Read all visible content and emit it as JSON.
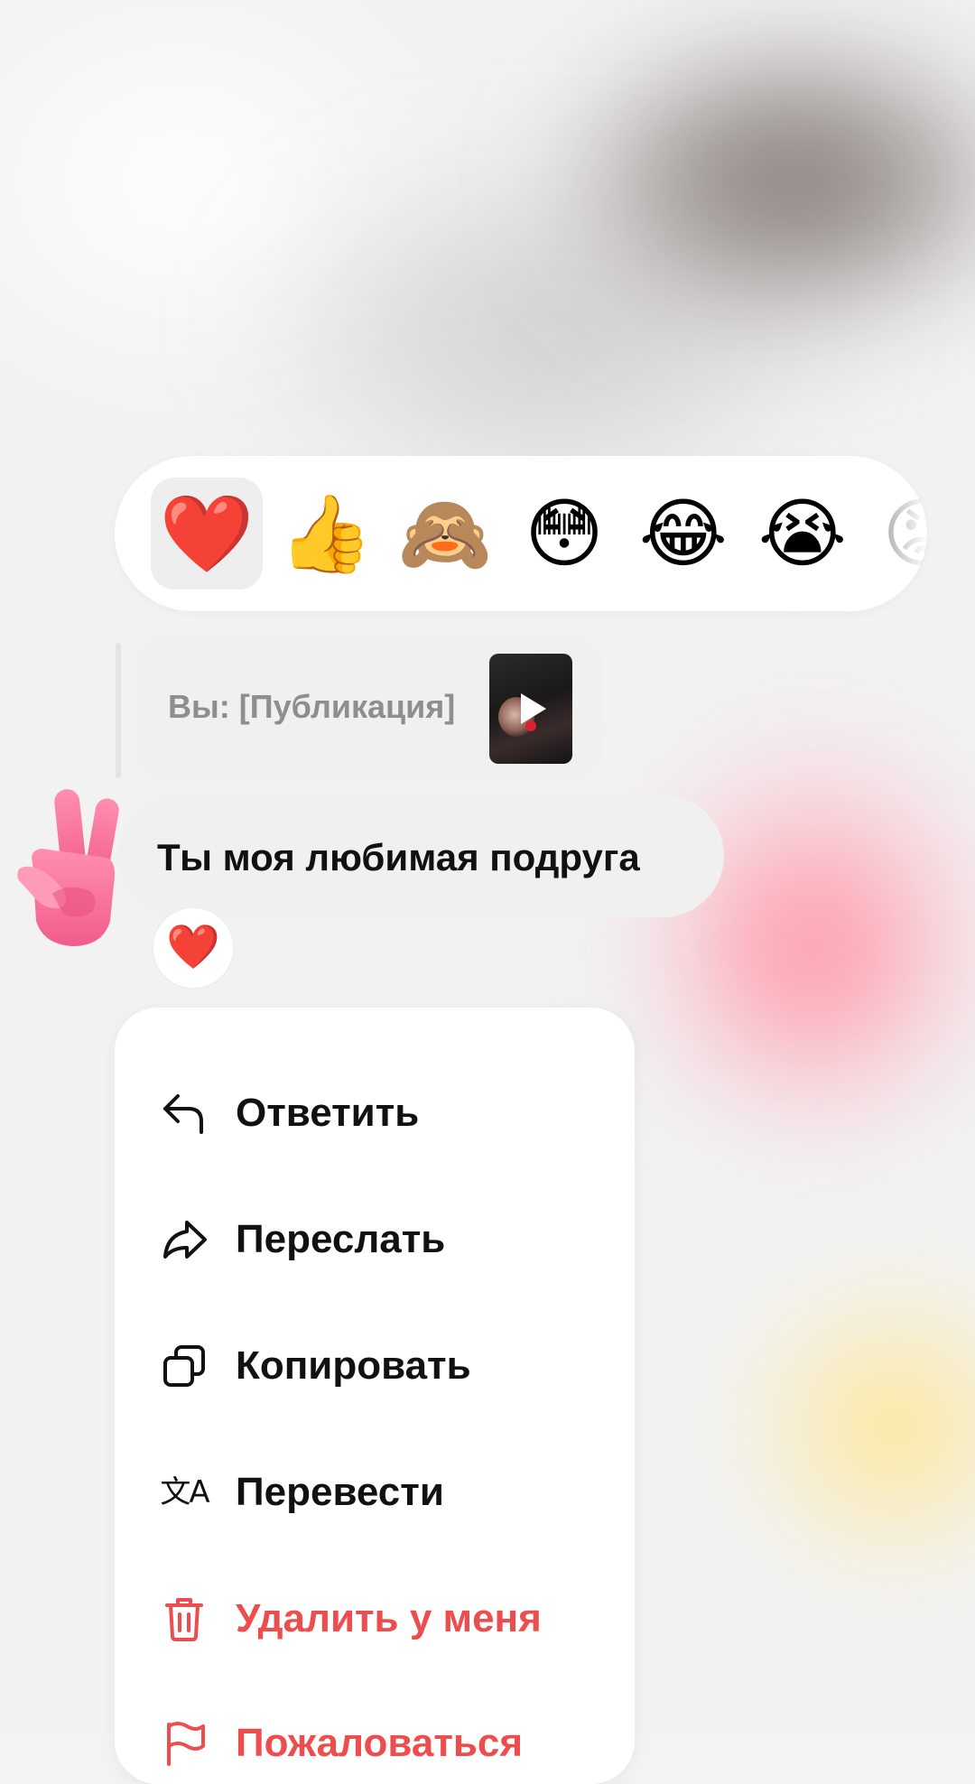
{
  "theme": {
    "menu_text_color": "#111111",
    "danger_color": "#EE4D4D",
    "bubble_color": "#F0F0F0",
    "panel_color": "#FFFFFF"
  },
  "reaction_bar": {
    "emojis": [
      {
        "name": "heart",
        "char": "❤️",
        "selected": true
      },
      {
        "name": "thumbs-up",
        "char": "👍",
        "selected": false
      },
      {
        "name": "see-no-evil-monkey",
        "char": "🙈",
        "selected": false
      },
      {
        "name": "flushed-face",
        "char": "😳",
        "selected": false
      },
      {
        "name": "tears-of-joy",
        "char": "😂",
        "selected": false
      },
      {
        "name": "loudly-crying-face",
        "char": "😭",
        "selected": false
      },
      {
        "name": "angry-face",
        "char": "😡",
        "selected": false
      }
    ]
  },
  "previous_message": {
    "text": "Вы: [Публикация]",
    "thumbnail_icon": "play-icon"
  },
  "message": {
    "text": "Ты моя любимая подруга",
    "sticker": "victory-hand",
    "reaction": "❤️"
  },
  "context_menu": {
    "items": [
      {
        "key": "reply",
        "label": "Ответить",
        "icon": "reply-arrow-icon",
        "danger": false
      },
      {
        "key": "forward",
        "label": "Переслать",
        "icon": "forward-arrow-icon",
        "danger": false
      },
      {
        "key": "copy",
        "label": "Копировать",
        "icon": "copy-icon",
        "danger": false
      },
      {
        "key": "translate",
        "label": "Перевести",
        "icon": "translate-icon",
        "danger": false
      },
      {
        "key": "delete",
        "label": "Удалить у меня",
        "icon": "trash-icon",
        "danger": true
      },
      {
        "key": "report",
        "label": "Пожаловаться",
        "icon": "flag-icon",
        "danger": true
      }
    ]
  }
}
